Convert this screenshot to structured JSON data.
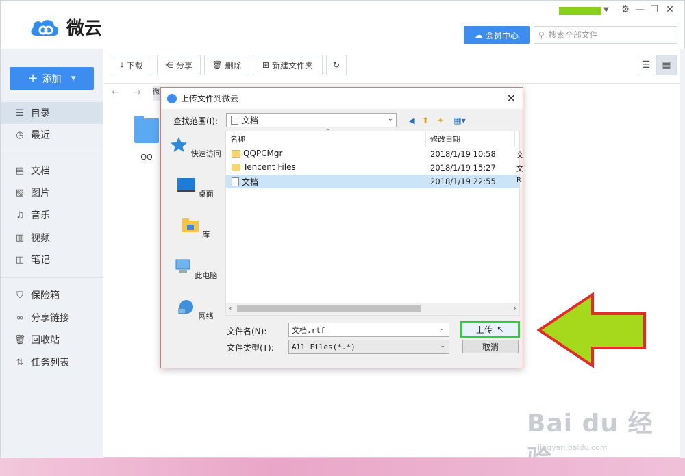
{
  "app": {
    "name": "微云",
    "vip_label": "会员中心",
    "search_placeholder": "搜索全部文件",
    "window_controls": [
      "⚙",
      "—",
      "☐",
      "✕"
    ]
  },
  "sidebar": {
    "add_label": "添加",
    "items": [
      {
        "label": "目录",
        "icon": "list-icon",
        "active": true
      },
      {
        "label": "最近",
        "icon": "clock-icon"
      },
      {
        "label": "文档",
        "icon": "document-icon"
      },
      {
        "label": "图片",
        "icon": "image-icon"
      },
      {
        "label": "音乐",
        "icon": "music-icon"
      },
      {
        "label": "视频",
        "icon": "video-icon"
      },
      {
        "label": "笔记",
        "icon": "note-icon"
      },
      {
        "label": "保险箱",
        "icon": "shield-icon"
      },
      {
        "label": "分享链接",
        "icon": "link-icon"
      },
      {
        "label": "回收站",
        "icon": "trash-icon"
      },
      {
        "label": "任务列表",
        "icon": "transfer-icon"
      }
    ]
  },
  "toolbar": {
    "download": "下载",
    "share": "分享",
    "delete": "删除",
    "new_folder": "新建文件夹"
  },
  "breadcrumb_partial": "微",
  "content": {
    "folders": [
      {
        "name": "QQ"
      }
    ]
  },
  "dialog": {
    "title": "上传文件到微云",
    "lookin_label": "查找范围(I):",
    "lookin_value": "文档",
    "places": [
      "快速访问",
      "桌面",
      "库",
      "此电脑",
      "网络"
    ],
    "columns": {
      "name": "名称",
      "date": "修改日期"
    },
    "files": [
      {
        "name": "QQPCMgr",
        "date": "2018/1/19 10:58",
        "type": "folder",
        "extra": "文"
      },
      {
        "name": "Tencent Files",
        "date": "2018/1/19 15:27",
        "type": "folder",
        "extra": "文"
      },
      {
        "name": "文档",
        "date": "2018/1/19 22:55",
        "type": "doc",
        "extra": "R",
        "selected": true
      }
    ],
    "filename_label": "文件名(N):",
    "filename_value": "文档.rtf",
    "filetype_label": "文件类型(T):",
    "filetype_value": "All Files(*.*)",
    "upload_label": "上传",
    "cancel_label": "取消"
  },
  "watermark": {
    "main": "Bai du 经验",
    "sub": "jingyan.baidu.com"
  },
  "colors": {
    "accent": "#3d8cf0",
    "highlight": "#2fcf36",
    "arrow_fill": "#a6d81c",
    "arrow_stroke": "#e52a2a"
  }
}
